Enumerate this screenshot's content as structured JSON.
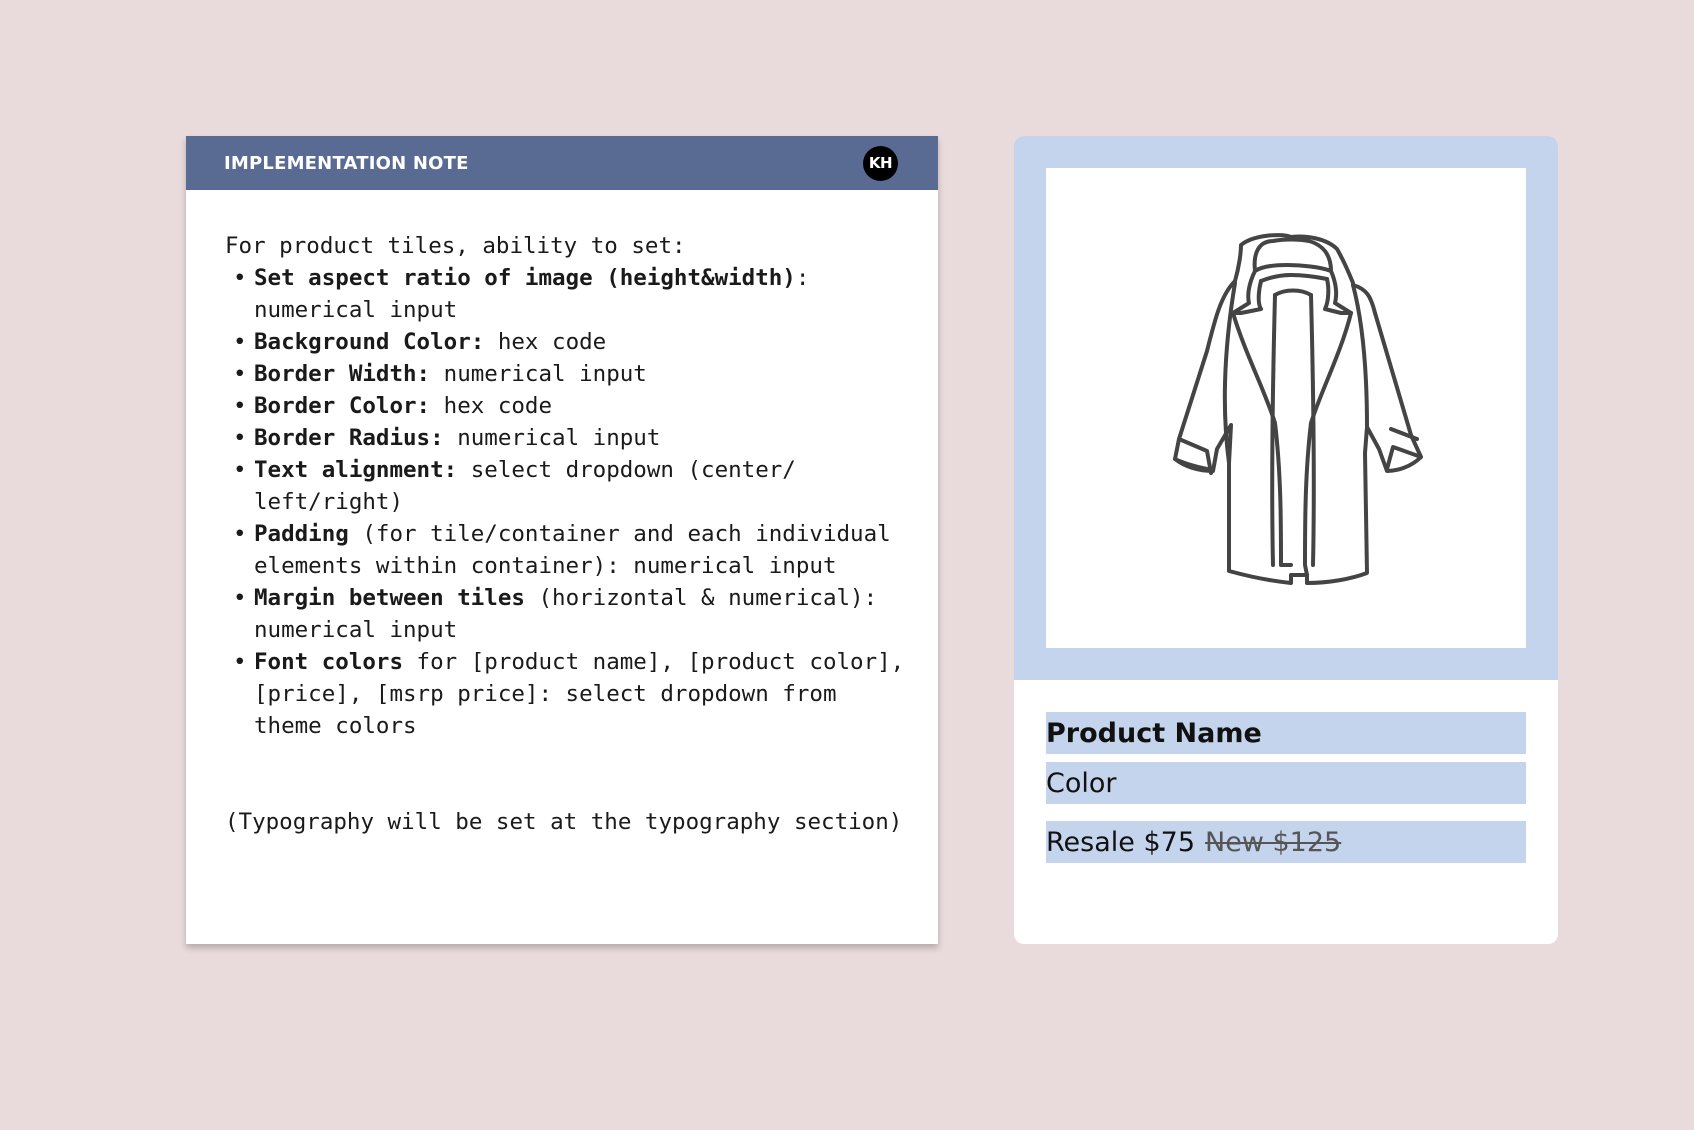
{
  "note": {
    "title": "IMPLEMENTATION NOTE",
    "avatar": "KH",
    "intro": "For product tiles, ability to set:",
    "items": [
      {
        "label": "Set aspect ratio of image (height&width)",
        "text": ": numerical input"
      },
      {
        "label": "Background Color:",
        "text": " hex code"
      },
      {
        "label": "Border Width:",
        "text": " numerical input"
      },
      {
        "label": "Border Color:",
        "text": " hex code"
      },
      {
        "label": "Border Radius:",
        "text": " numerical input"
      },
      {
        "label": "Text alignment:",
        "text": " select dropdown (center/ left/right)"
      },
      {
        "label": "Padding",
        "text": " (for tile/container and each individual elements within container): numerical input"
      },
      {
        "label": "Margin between tiles",
        "text": " (horizontal & numerical): numerical input"
      },
      {
        "label": "Font colors",
        "text": " for [product name], [product color], [price], [msrp price]: select dropdown from theme colors"
      }
    ],
    "footer": "(Typography will be set at the typography section)"
  },
  "product": {
    "image_icon": "coat-icon",
    "name": "Product Name",
    "color": "Color",
    "price": "Resale $75",
    "msrp": "New $125"
  },
  "colors": {
    "background": "#e9dadb",
    "note_header": "#5a6b93",
    "tile_accent": "#c5d4ed"
  }
}
